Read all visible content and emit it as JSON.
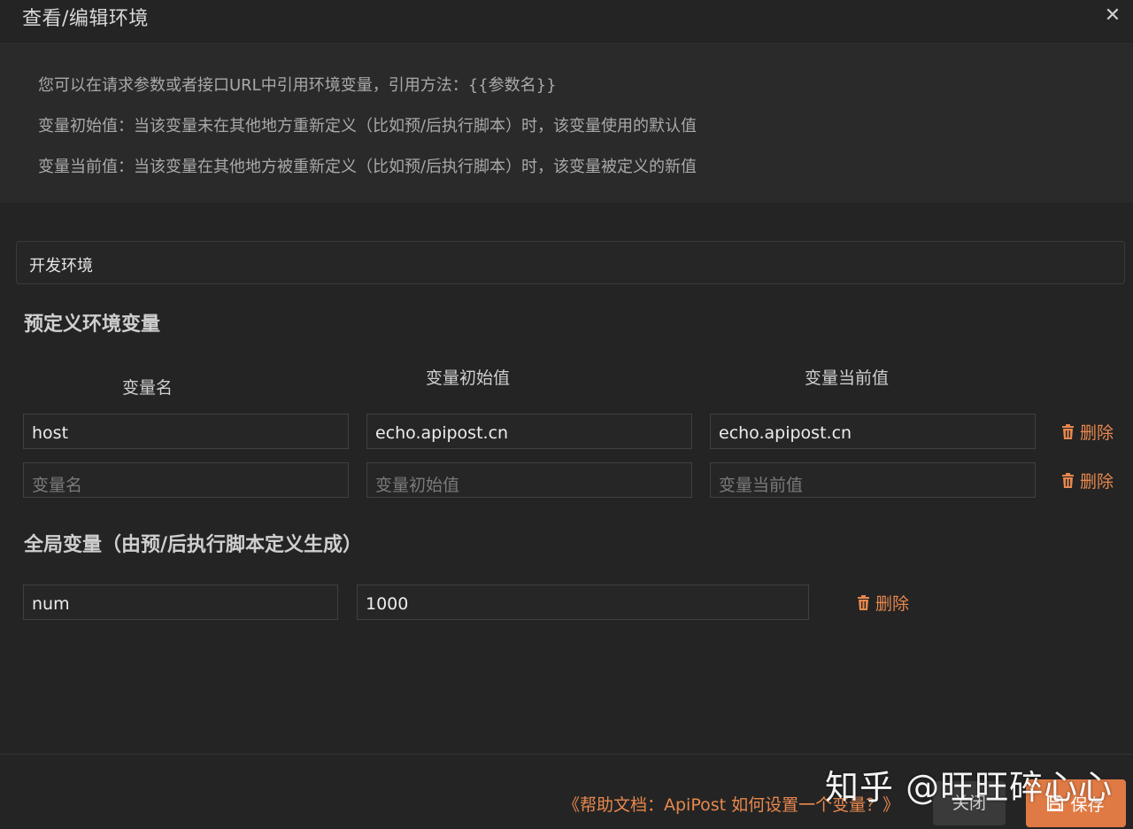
{
  "dialog": {
    "title": "查看/编辑环境",
    "close_icon": "close-icon"
  },
  "info": {
    "line1": "您可以在请求参数或者接口URL中引用环境变量，引用方法：{{参数名}}",
    "line2": "变量初始值：当该变量未在其他地方重新定义（比如预/后执行脚本）时，该变量使用的默认值",
    "line3": "变量当前值：当该变量在其他地方被重新定义（比如预/后执行脚本）时，该变量被定义的新值"
  },
  "env": {
    "name": "开发环境"
  },
  "predefined": {
    "section_title": "预定义环境变量",
    "col_name": "变量名",
    "col_initial": "变量初始值",
    "col_current": "变量当前值",
    "rows": [
      {
        "name": "host",
        "initial": "echo.apipost.cn",
        "current": "echo.apipost.cn",
        "delete_label": "删除"
      },
      {
        "name_placeholder": "变量名",
        "initial_placeholder": "变量初始值",
        "current_placeholder": "变量当前值",
        "delete_label": "删除"
      }
    ]
  },
  "global": {
    "section_title": "全局变量（由预/后执行脚本定义生成）",
    "rows": [
      {
        "name": "num",
        "value": "1000",
        "delete_label": "删除"
      }
    ]
  },
  "footer": {
    "help_link": "《帮助文档：ApiPost 如何设置一个变量？》",
    "close_label": "关闭",
    "save_label": "保存"
  },
  "watermark": "知乎 @旺旺碎心心",
  "colors": {
    "accent": "#e07a44",
    "delete": "#e8884e",
    "background": "#242424"
  },
  "icons": {
    "delete": "trash-icon",
    "save": "save-icon"
  }
}
